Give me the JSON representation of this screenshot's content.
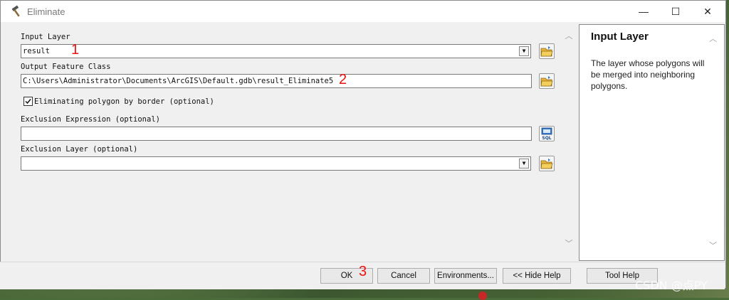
{
  "window": {
    "title": "Eliminate",
    "min_glyph": "—",
    "max_glyph": "☐",
    "close_glyph": "✕"
  },
  "form": {
    "input_layer": {
      "label": "Input Layer",
      "value": "result",
      "annotation": "1"
    },
    "output_feature_class": {
      "label": "Output Feature Class",
      "value": "C:\\Users\\Administrator\\Documents\\ArcGIS\\Default.gdb\\result_Eliminate5",
      "annotation": "2"
    },
    "eliminate_by_border": {
      "label": "Eliminating polygon by border (optional)",
      "checked": true
    },
    "exclusion_expression": {
      "label": "Exclusion Expression (optional)",
      "value": ""
    },
    "exclusion_layer": {
      "label": "Exclusion Layer (optional)",
      "value": ""
    }
  },
  "help": {
    "title": "Input Layer",
    "text": "The layer whose polygons will be merged into neighboring polygons."
  },
  "buttons": {
    "ok": "OK",
    "ok_annotation": "3",
    "cancel": "Cancel",
    "environments": "Environments...",
    "hide_help": "<< Hide Help",
    "tool_help": "Tool Help"
  },
  "watermark": "CSDN @点PY",
  "icons": [
    "hammer-icon",
    "folder-open-icon",
    "sql-icon",
    "dropdown-arrow-icon",
    "checkbox-checked-icon"
  ]
}
